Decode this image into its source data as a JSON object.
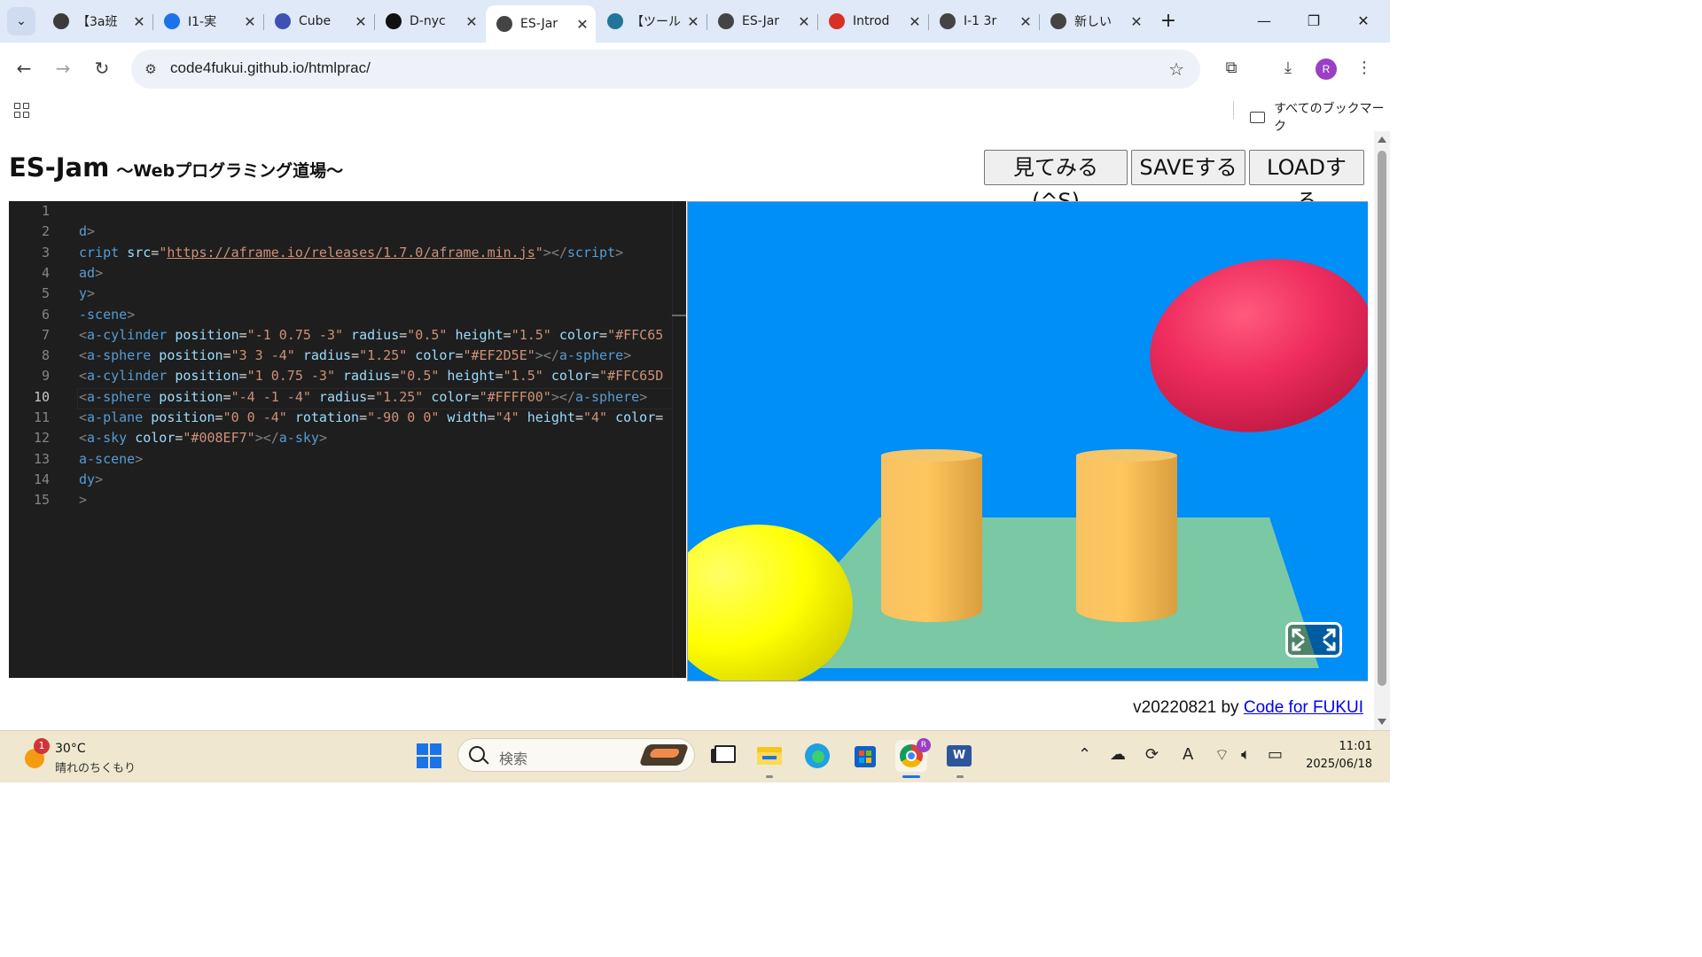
{
  "browser": {
    "tabs": [
      {
        "title": "【3a班",
        "icon": "ai-tab-icon",
        "color": "#3c3c3c"
      },
      {
        "title": "I1-実",
        "icon": "drive-icon",
        "color": "#1a73e8"
      },
      {
        "title": "Cube",
        "icon": "cube-icon",
        "color": "#3f51b5"
      },
      {
        "title": "D-nyc",
        "icon": "github-icon",
        "color": "#111111"
      },
      {
        "title": "ES-Jar",
        "icon": "globe-icon",
        "color": "#444444",
        "active": true
      },
      {
        "title": "【ツール",
        "icon": "wordpress-icon",
        "color": "#21759b"
      },
      {
        "title": "ES-Jar",
        "icon": "globe-icon",
        "color": "#444444"
      },
      {
        "title": "Introd",
        "icon": "a-icon",
        "color": "#d93025"
      },
      {
        "title": "I-1 3r",
        "icon": "globe-icon",
        "color": "#444444"
      },
      {
        "title": "新しい",
        "icon": "chrome-icon",
        "color": "#444444"
      }
    ],
    "close_glyph": "✕",
    "new_tab_glyph": "+",
    "url": "code4fukui.github.io/htmlprac/",
    "profile_initial": "R",
    "bookmarks_all": "すべてのブックマーク"
  },
  "page": {
    "title": "ES-Jam",
    "subtitle": "〜Webプログラミング道場〜",
    "buttons": {
      "preview": "見てみる (^S)",
      "save": "SAVEする",
      "load": "LOADする"
    },
    "footer_version": "v20220821 by ",
    "footer_link": "Code for FUKUI"
  },
  "editor": {
    "current_line": 10,
    "lines": [
      {
        "n": "1",
        "tokens": []
      },
      {
        "n": "2",
        "tokens": [
          {
            "t": "d",
            "c": "tg"
          },
          {
            "t": ">",
            "c": "pu"
          }
        ]
      },
      {
        "n": "3",
        "tokens": [
          {
            "t": "cript",
            "c": "tg"
          },
          {
            "t": " ",
            "c": "eq"
          },
          {
            "t": "src",
            "c": "an"
          },
          {
            "t": "=",
            "c": "eq"
          },
          {
            "t": "\"",
            "c": "av"
          },
          {
            "t": "https://aframe.io/releases/1.7.0/aframe.min.js",
            "c": "av url"
          },
          {
            "t": "\"",
            "c": "av"
          },
          {
            "t": "></",
            "c": "pu"
          },
          {
            "t": "script",
            "c": "tg"
          },
          {
            "t": ">",
            "c": "pu"
          }
        ]
      },
      {
        "n": "4",
        "tokens": [
          {
            "t": "ad",
            "c": "tg"
          },
          {
            "t": ">",
            "c": "pu"
          }
        ]
      },
      {
        "n": "5",
        "tokens": [
          {
            "t": "y",
            "c": "tg"
          },
          {
            "t": ">",
            "c": "pu"
          }
        ]
      },
      {
        "n": "6",
        "tokens": [
          {
            "t": "-scene",
            "c": "tg"
          },
          {
            "t": ">",
            "c": "pu"
          }
        ]
      },
      {
        "n": "7",
        "tokens": [
          {
            "t": "<",
            "c": "pu"
          },
          {
            "t": "a-cylinder",
            "c": "tg"
          },
          {
            "t": " position",
            "c": "an"
          },
          {
            "t": "=",
            "c": "eq"
          },
          {
            "t": "\"-1 0.75 -3\"",
            "c": "av"
          },
          {
            "t": " radius",
            "c": "an"
          },
          {
            "t": "=",
            "c": "eq"
          },
          {
            "t": "\"0.5\"",
            "c": "av"
          },
          {
            "t": " height",
            "c": "an"
          },
          {
            "t": "=",
            "c": "eq"
          },
          {
            "t": "\"1.5\"",
            "c": "av"
          },
          {
            "t": " color",
            "c": "an"
          },
          {
            "t": "=",
            "c": "eq"
          },
          {
            "t": "\"#FFC65",
            "c": "av"
          }
        ]
      },
      {
        "n": "8",
        "tokens": [
          {
            "t": "<",
            "c": "pu"
          },
          {
            "t": "a-sphere",
            "c": "tg"
          },
          {
            "t": " position",
            "c": "an"
          },
          {
            "t": "=",
            "c": "eq"
          },
          {
            "t": "\"3 3 -4\"",
            "c": "av"
          },
          {
            "t": " radius",
            "c": "an"
          },
          {
            "t": "=",
            "c": "eq"
          },
          {
            "t": "\"1.25\"",
            "c": "av"
          },
          {
            "t": " color",
            "c": "an"
          },
          {
            "t": "=",
            "c": "eq"
          },
          {
            "t": "\"#EF2D5E\"",
            "c": "av"
          },
          {
            "t": "></",
            "c": "pu"
          },
          {
            "t": "a-sphere",
            "c": "tg"
          },
          {
            "t": ">",
            "c": "pu"
          }
        ]
      },
      {
        "n": "9",
        "tokens": [
          {
            "t": "<",
            "c": "pu"
          },
          {
            "t": "a-cylinder",
            "c": "tg"
          },
          {
            "t": " position",
            "c": "an"
          },
          {
            "t": "=",
            "c": "eq"
          },
          {
            "t": "\"1 0.75 -3\"",
            "c": "av"
          },
          {
            "t": " radius",
            "c": "an"
          },
          {
            "t": "=",
            "c": "eq"
          },
          {
            "t": "\"0.5\"",
            "c": "av"
          },
          {
            "t": " height",
            "c": "an"
          },
          {
            "t": "=",
            "c": "eq"
          },
          {
            "t": "\"1.5\"",
            "c": "av"
          },
          {
            "t": " color",
            "c": "an"
          },
          {
            "t": "=",
            "c": "eq"
          },
          {
            "t": "\"#FFC65D",
            "c": "av"
          }
        ]
      },
      {
        "n": "10",
        "tokens": [
          {
            "t": "<",
            "c": "pu"
          },
          {
            "t": "a-sphere",
            "c": "tg"
          },
          {
            "t": " position",
            "c": "an"
          },
          {
            "t": "=",
            "c": "eq"
          },
          {
            "t": "\"-4 -1 -4\"",
            "c": "av"
          },
          {
            "t": " radius",
            "c": "an"
          },
          {
            "t": "=",
            "c": "eq"
          },
          {
            "t": "\"1.25\"",
            "c": "av"
          },
          {
            "t": " color",
            "c": "an"
          },
          {
            "t": "=",
            "c": "eq"
          },
          {
            "t": "\"#FFFF00\"",
            "c": "av"
          },
          {
            "t": "></",
            "c": "pu"
          },
          {
            "t": "a-sphere",
            "c": "tg"
          },
          {
            "t": ">",
            "c": "pu"
          }
        ]
      },
      {
        "n": "11",
        "tokens": [
          {
            "t": "<",
            "c": "pu"
          },
          {
            "t": "a-plane",
            "c": "tg"
          },
          {
            "t": " position",
            "c": "an"
          },
          {
            "t": "=",
            "c": "eq"
          },
          {
            "t": "\"0 0 -4\"",
            "c": "av"
          },
          {
            "t": " rotation",
            "c": "an"
          },
          {
            "t": "=",
            "c": "eq"
          },
          {
            "t": "\"-90 0 0\"",
            "c": "av"
          },
          {
            "t": " width",
            "c": "an"
          },
          {
            "t": "=",
            "c": "eq"
          },
          {
            "t": "\"4\"",
            "c": "av"
          },
          {
            "t": " height",
            "c": "an"
          },
          {
            "t": "=",
            "c": "eq"
          },
          {
            "t": "\"4\"",
            "c": "av"
          },
          {
            "t": " color",
            "c": "an"
          },
          {
            "t": "=",
            "c": "eq"
          }
        ]
      },
      {
        "n": "12",
        "tokens": [
          {
            "t": "<",
            "c": "pu"
          },
          {
            "t": "a-sky",
            "c": "tg"
          },
          {
            "t": " color",
            "c": "an"
          },
          {
            "t": "=",
            "c": "eq"
          },
          {
            "t": "\"#008EF7\"",
            "c": "av"
          },
          {
            "t": "></",
            "c": "pu"
          },
          {
            "t": "a-sky",
            "c": "tg"
          },
          {
            "t": ">",
            "c": "pu"
          }
        ]
      },
      {
        "n": "13",
        "tokens": [
          {
            "t": "a-scene",
            "c": "tg"
          },
          {
            "t": ">",
            "c": "pu"
          }
        ]
      },
      {
        "n": "14",
        "tokens": [
          {
            "t": "dy",
            "c": "tg"
          },
          {
            "t": ">",
            "c": "pu"
          }
        ]
      },
      {
        "n": "15",
        "tokens": [
          {
            "t": ">",
            "c": "pu"
          }
        ]
      }
    ]
  },
  "scene_colors": {
    "sky": "#008EF7",
    "plane": "#7BC8A4",
    "cylinder": "#FFC65D",
    "sphere_red": "#EF2D5E",
    "sphere_yellow": "#FFFF00"
  },
  "taskbar": {
    "weather_temp": "30°C",
    "weather_desc": "晴れのちくもり",
    "weather_badge": "1",
    "search_placeholder": "検索",
    "time": "11:01",
    "date": "2025/06/18",
    "ime_glyph": "A"
  }
}
